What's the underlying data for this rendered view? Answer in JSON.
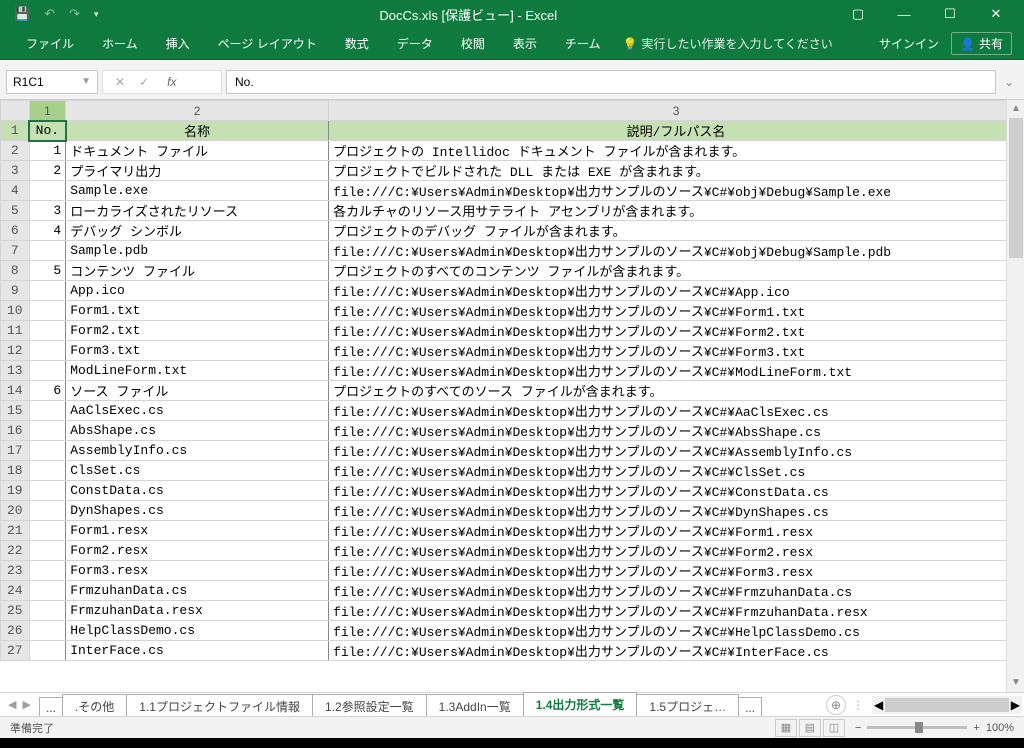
{
  "title_bar": {
    "doc_title": "DocCs.xls  [保護ビュー] - Excel"
  },
  "ribbon": {
    "tabs": [
      "ファイル",
      "ホーム",
      "挿入",
      "ページ レイアウト",
      "数式",
      "データ",
      "校閲",
      "表示",
      "チーム"
    ],
    "tell_me": "実行したい作業を入力してください",
    "signin": "サインイン",
    "share": "共有"
  },
  "formula_bar": {
    "name_box": "R1C1",
    "formula": "No."
  },
  "grid": {
    "col_headers": [
      "",
      "1",
      "2",
      "3"
    ],
    "data_header": {
      "no": "No.",
      "name": "名称",
      "desc": "説明/フルパス名"
    },
    "rows": [
      {
        "r": "1",
        "no": "",
        "name": "",
        "desc": ""
      },
      {
        "r": "2",
        "no": "1",
        "name": "ドキュメント ファイル",
        "desc": "プロジェクトの Intellidoc ドキュメント ファイルが含まれます。"
      },
      {
        "r": "3",
        "no": "2",
        "name": "プライマリ出力",
        "desc": "プロジェクトでビルドされた DLL または EXE が含まれます。"
      },
      {
        "r": "4",
        "no": "",
        "name": "Sample.exe",
        "desc": "file:///C:¥Users¥Admin¥Desktop¥出力サンプルのソース¥C#¥obj¥Debug¥Sample.exe"
      },
      {
        "r": "5",
        "no": "3",
        "name": "ローカライズされたリソース",
        "desc": "各カルチャのリソース用サテライト アセンブリが含まれます。"
      },
      {
        "r": "6",
        "no": "4",
        "name": "デバッグ シンボル",
        "desc": "プロジェクトのデバッグ ファイルが含まれます。"
      },
      {
        "r": "7",
        "no": "",
        "name": "Sample.pdb",
        "desc": "file:///C:¥Users¥Admin¥Desktop¥出力サンプルのソース¥C#¥obj¥Debug¥Sample.pdb"
      },
      {
        "r": "8",
        "no": "5",
        "name": "コンテンツ ファイル",
        "desc": "プロジェクトのすべてのコンテンツ ファイルが含まれます。"
      },
      {
        "r": "9",
        "no": "",
        "name": "App.ico",
        "desc": "file:///C:¥Users¥Admin¥Desktop¥出力サンプルのソース¥C#¥App.ico"
      },
      {
        "r": "10",
        "no": "",
        "name": "Form1.txt",
        "desc": "file:///C:¥Users¥Admin¥Desktop¥出力サンプルのソース¥C#¥Form1.txt"
      },
      {
        "r": "11",
        "no": "",
        "name": "Form2.txt",
        "desc": "file:///C:¥Users¥Admin¥Desktop¥出力サンプルのソース¥C#¥Form2.txt"
      },
      {
        "r": "12",
        "no": "",
        "name": "Form3.txt",
        "desc": "file:///C:¥Users¥Admin¥Desktop¥出力サンプルのソース¥C#¥Form3.txt"
      },
      {
        "r": "13",
        "no": "",
        "name": "ModLineForm.txt",
        "desc": "file:///C:¥Users¥Admin¥Desktop¥出力サンプルのソース¥C#¥ModLineForm.txt"
      },
      {
        "r": "14",
        "no": "6",
        "name": "ソース ファイル",
        "desc": "プロジェクトのすべてのソース ファイルが含まれます。"
      },
      {
        "r": "15",
        "no": "",
        "name": "AaClsExec.cs",
        "desc": "file:///C:¥Users¥Admin¥Desktop¥出力サンプルのソース¥C#¥AaClsExec.cs"
      },
      {
        "r": "16",
        "no": "",
        "name": "AbsShape.cs",
        "desc": "file:///C:¥Users¥Admin¥Desktop¥出力サンプルのソース¥C#¥AbsShape.cs"
      },
      {
        "r": "17",
        "no": "",
        "name": "AssemblyInfo.cs",
        "desc": "file:///C:¥Users¥Admin¥Desktop¥出力サンプルのソース¥C#¥AssemblyInfo.cs"
      },
      {
        "r": "18",
        "no": "",
        "name": "ClsSet.cs",
        "desc": "file:///C:¥Users¥Admin¥Desktop¥出力サンプルのソース¥C#¥ClsSet.cs"
      },
      {
        "r": "19",
        "no": "",
        "name": "ConstData.cs",
        "desc": "file:///C:¥Users¥Admin¥Desktop¥出力サンプルのソース¥C#¥ConstData.cs"
      },
      {
        "r": "20",
        "no": "",
        "name": "DynShapes.cs",
        "desc": "file:///C:¥Users¥Admin¥Desktop¥出力サンプルのソース¥C#¥DynShapes.cs"
      },
      {
        "r": "21",
        "no": "",
        "name": "Form1.resx",
        "desc": "file:///C:¥Users¥Admin¥Desktop¥出力サンプルのソース¥C#¥Form1.resx"
      },
      {
        "r": "22",
        "no": "",
        "name": "Form2.resx",
        "desc": "file:///C:¥Users¥Admin¥Desktop¥出力サンプルのソース¥C#¥Form2.resx"
      },
      {
        "r": "23",
        "no": "",
        "name": "Form3.resx",
        "desc": "file:///C:¥Users¥Admin¥Desktop¥出力サンプルのソース¥C#¥Form3.resx"
      },
      {
        "r": "24",
        "no": "",
        "name": "FrmzuhanData.cs",
        "desc": "file:///C:¥Users¥Admin¥Desktop¥出力サンプルのソース¥C#¥FrmzuhanData.cs"
      },
      {
        "r": "25",
        "no": "",
        "name": "FrmzuhanData.resx",
        "desc": "file:///C:¥Users¥Admin¥Desktop¥出力サンプルのソース¥C#¥FrmzuhanData.resx"
      },
      {
        "r": "26",
        "no": "",
        "name": "HelpClassDemo.cs",
        "desc": "file:///C:¥Users¥Admin¥Desktop¥出力サンプルのソース¥C#¥HelpClassDemo.cs"
      },
      {
        "r": "27",
        "no": "",
        "name": "InterFace.cs",
        "desc": "file:///C:¥Users¥Admin¥Desktop¥出力サンプルのソース¥C#¥InterFace.cs"
      }
    ]
  },
  "sheet_tabs": {
    "more_left": "...",
    "tabs": [
      ".その他",
      "1.1プロジェクトファイル情報",
      "1.2参照設定一覧",
      "1.3AddIn一覧",
      "1.4出力形式一覧",
      "1.5プロジェ…"
    ],
    "more_right": "...",
    "active_index": 4
  },
  "status_bar": {
    "ready": "準備完了",
    "zoom": "100%"
  }
}
